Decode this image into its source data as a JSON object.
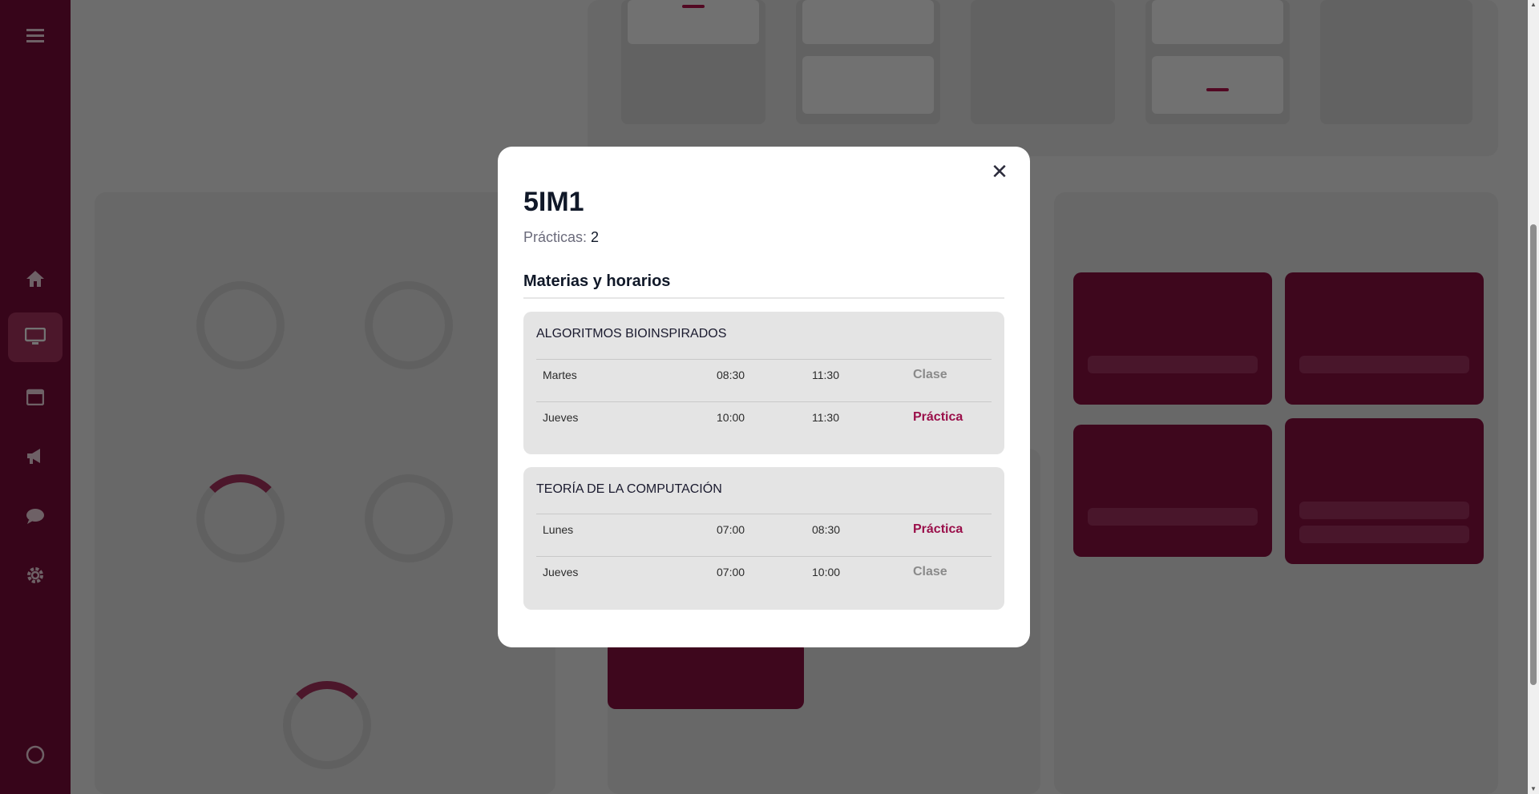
{
  "modal": {
    "title": "5IM1",
    "practicas_label": "Prácticas:",
    "practicas_value": "2",
    "section_title": "Materias y horarios",
    "close_symbol": "✕",
    "subjects": [
      {
        "name": "ALGORITMOS BIOINSPIRADOS",
        "rows": [
          {
            "day": "Martes",
            "start": "08:30",
            "end": "11:30",
            "kind": "Clase"
          },
          {
            "day": "Jueves",
            "start": "10:00",
            "end": "11:30",
            "kind": "Práctica"
          }
        ]
      },
      {
        "name": "TEORÍA DE LA COMPUTACIÓN",
        "rows": [
          {
            "day": "Lunes",
            "start": "07:00",
            "end": "08:30",
            "kind": "Práctica"
          },
          {
            "day": "Jueves",
            "start": "07:00",
            "end": "10:00",
            "kind": "Clase"
          }
        ]
      }
    ]
  },
  "colors": {
    "brand": "#7a0c3a",
    "accent": "#9a0f4a",
    "clase": "#8a8a8a"
  },
  "sidebar": {
    "icons": [
      "menu-icon",
      "home-icon",
      "monitor-icon",
      "calendar-icon",
      "megaphone-icon",
      "chat-icon",
      "settings-icon",
      "logout-icon"
    ]
  }
}
